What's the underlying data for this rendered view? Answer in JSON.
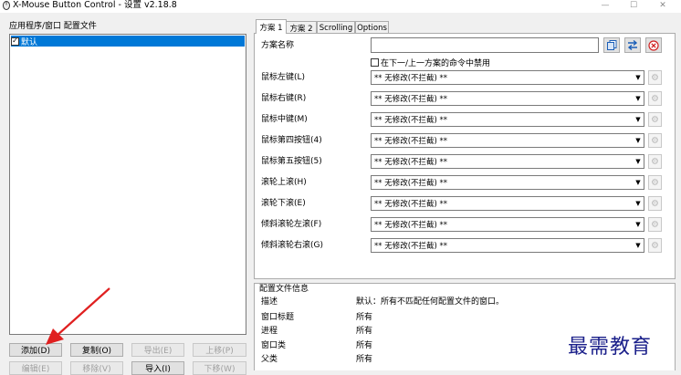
{
  "window": {
    "title": "X-Mouse Button Control - 设置 v2.18.8",
    "minimize_icon": "—",
    "maximize_icon": "☐",
    "close_icon": "✕"
  },
  "left_panel": {
    "label": "应用程序/窗口 配置文件",
    "items": [
      {
        "label": "默认",
        "checked": true
      }
    ],
    "buttons": {
      "add": "添加(D)",
      "copy": "复制(O)",
      "export": "导出(E)",
      "move_up": "上移(P)",
      "edit": "编辑(E)",
      "remove": "移除(V)",
      "import": "导入(I)",
      "move_down": "下移(W)"
    }
  },
  "tabs": [
    "方案 1",
    "方案 2",
    "Scrolling",
    "Options"
  ],
  "scheme": {
    "name_label": "方案名称",
    "name_value": "",
    "disable_checkbox_label": "在下一/上一方案的命令中禁用"
  },
  "mappings": [
    {
      "label": "鼠标左键(L)",
      "value": "** 无修改(不拦截) **"
    },
    {
      "label": "鼠标右键(R)",
      "value": "** 无修改(不拦截) **"
    },
    {
      "label": "鼠标中键(M)",
      "value": "** 无修改(不拦截) **"
    },
    {
      "label": "鼠标第四按钮(4)",
      "value": "** 无修改(不拦截) **"
    },
    {
      "label": "鼠标第五按钮(5)",
      "value": "** 无修改(不拦截) **"
    },
    {
      "label": "滚轮上滚(H)",
      "value": "** 无修改(不拦截) **"
    },
    {
      "label": "滚轮下滚(E)",
      "value": "** 无修改(不拦截) **"
    },
    {
      "label": "倾斜滚轮左滚(F)",
      "value": "** 无修改(不拦截) **"
    },
    {
      "label": "倾斜滚轮右滚(G)",
      "value": "** 无修改(不拦截) **"
    }
  ],
  "info": {
    "section_title": "配置文件信息",
    "rows": [
      {
        "key": "描述",
        "value": "默认：所有不匹配任何配置文件的窗口。"
      },
      {
        "key": "窗口标题",
        "value": "所有"
      },
      {
        "key": "进程",
        "value": "所有"
      },
      {
        "key": "窗口类",
        "value": "所有"
      },
      {
        "key": "父类",
        "value": "所有"
      }
    ]
  },
  "watermark": "最需教育",
  "colors": {
    "selection": "#0078d7",
    "arrow": "#e02020",
    "watermark": "#1a1f8a"
  }
}
